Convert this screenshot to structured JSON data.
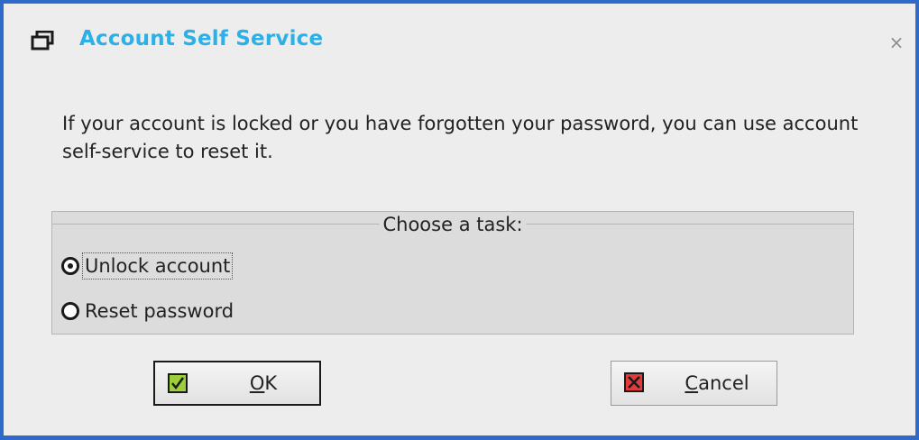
{
  "window": {
    "title": "Account Self Service",
    "close_glyph": "×",
    "title_icon": "restore-windows-icon",
    "title_color": "#2bb0e8",
    "border_color": "#2f6ac8"
  },
  "message": "If your account is locked or you have forgotten your password, you can use account self-service to reset it.",
  "task_group": {
    "legend": "Choose a task:",
    "options": [
      {
        "label": "Unlock account",
        "checked": true
      },
      {
        "label": "Reset password",
        "checked": false
      }
    ]
  },
  "buttons": {
    "ok": {
      "mnemonic": "O",
      "rest": "K",
      "icon": "green-check-icon"
    },
    "cancel": {
      "mnemonic": "C",
      "rest": "ancel",
      "icon": "red-x-icon"
    }
  }
}
